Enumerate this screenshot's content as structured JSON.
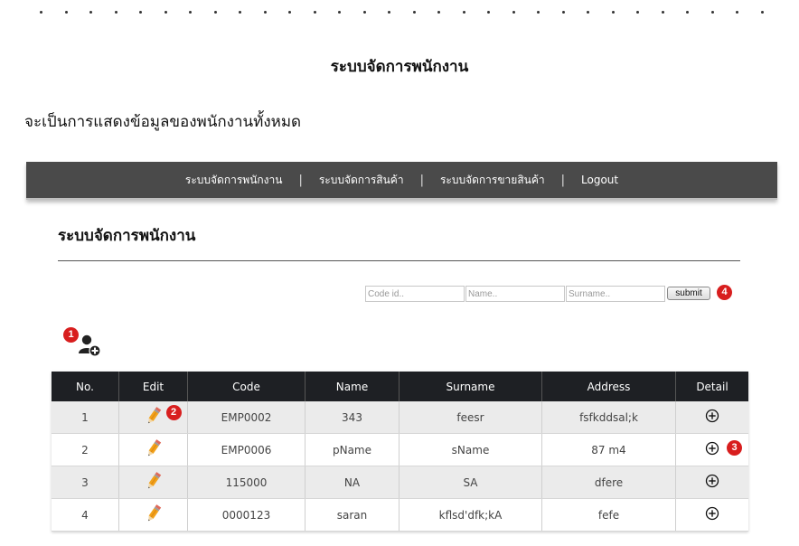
{
  "page": {
    "heading": "ระบบจัดการพนักงาน",
    "description": "จะเป็นการแสดงข้อมูลของพนักงานทั้งหมด"
  },
  "navbar": {
    "items": [
      "ระบบจัดการพนักงาน",
      "ระบบจัดการสินค้า",
      "ระบบจัดการขายสินค้า",
      "Logout"
    ],
    "separator": "|"
  },
  "section": {
    "title": "ระบบจัดการพนักงาน"
  },
  "search": {
    "code_placeholder": "Code id..",
    "name_placeholder": "Name..",
    "surname_placeholder": "Surname..",
    "submit_label": "submit"
  },
  "badges": [
    "1",
    "2",
    "3",
    "4"
  ],
  "table": {
    "headers": [
      "No.",
      "Edit",
      "Code",
      "Name",
      "Surname",
      "Address",
      "Detail"
    ],
    "rows": [
      {
        "no": "1",
        "code": "EMP0002",
        "name": "343",
        "surname": "feesr",
        "address": "fsfkddsal;k"
      },
      {
        "no": "2",
        "code": "EMP0006",
        "name": "pName",
        "surname": "sName",
        "address": "87 m4"
      },
      {
        "no": "3",
        "code": "115000",
        "name": "NA",
        "surname": "SA",
        "address": "dfere"
      },
      {
        "no": "4",
        "code": "0000123",
        "name": "saran",
        "surname": "kflsd'dfk;kA",
        "address": "fefe"
      }
    ]
  },
  "icons": {
    "add_user": "add-user-icon",
    "edit": "pencil-icon",
    "detail": "plus-circle-icon"
  },
  "colors": {
    "navbar_bg": "#4a4a4a",
    "table_header_bg": "#1e2024",
    "badge": "#d81e1e",
    "pencil": "#f2a21b"
  }
}
